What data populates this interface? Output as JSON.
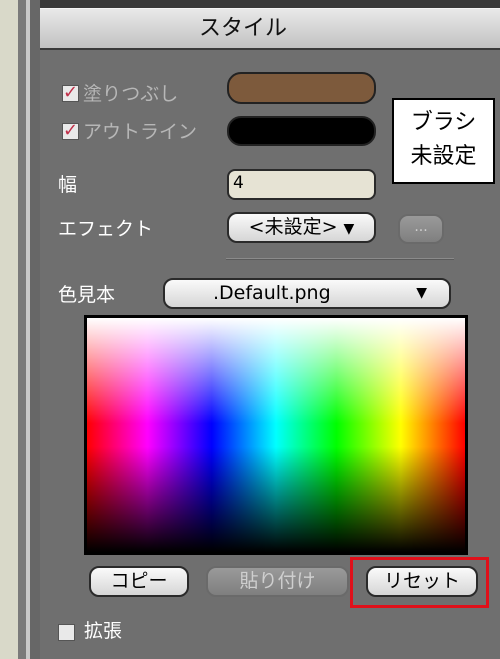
{
  "panel": {
    "title": "スタイル"
  },
  "style": {
    "fill_label": "塗りつぶし",
    "fill_checked": true,
    "fill_color": "#7d5a3c",
    "outline_label": "アウトライン",
    "outline_checked": true,
    "outline_color": "#000000",
    "width_label": "幅",
    "width_value": "4",
    "effect_label": "エフェクト",
    "effect_value": "<未設定>",
    "effect_options_button": "...",
    "brush_label_line1": "ブラシ",
    "brush_label_line2": "未設定"
  },
  "swatches": {
    "label": "色見本",
    "file_value": ".Default.png",
    "copy_button": "コピー",
    "paste_button": "貼り付け",
    "reset_button": "リセット"
  },
  "expand": {
    "label": "拡張",
    "checked": false
  },
  "icons": {
    "dropdown": "triangle-down",
    "check": "check-mark"
  },
  "colors": {
    "panel_bg": "#6f6f6f",
    "highlight": "#e0101a"
  }
}
